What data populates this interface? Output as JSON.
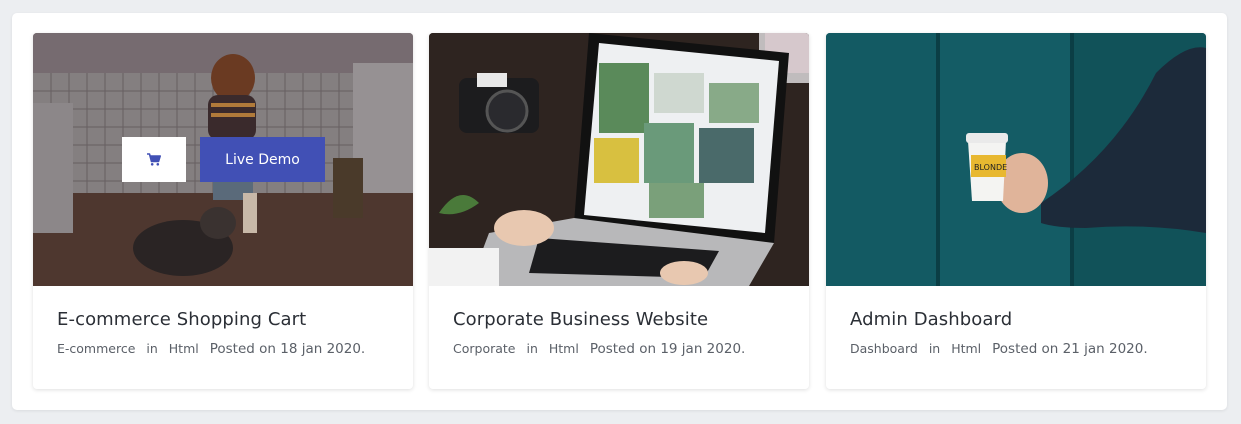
{
  "cards": [
    {
      "title": "E-commerce Shopping Cart",
      "category": "E-commerce",
      "in_word": "in",
      "tech": "Html",
      "posted": "Posted on 18 jan 2020.",
      "image_icon": "photo-woman-with-dog",
      "actions": {
        "cart_icon": "cart-icon",
        "demo_label": "Live Demo"
      }
    },
    {
      "title": "Corporate Business Website",
      "category": "Corporate",
      "in_word": "in",
      "tech": "Html",
      "posted": "Posted on 19 jan 2020.",
      "image_icon": "photo-laptop-desk"
    },
    {
      "title": "Admin Dashboard",
      "category": "Dashboard",
      "in_word": "in",
      "tech": "Html",
      "posted": "Posted on 21 jan 2020.",
      "image_icon": "photo-hand-coffee-cup"
    }
  ],
  "colors": {
    "accent": "#4150b5",
    "page_bg": "#eceef1",
    "title_text": "#2b2f36",
    "meta_text": "#5b6068"
  }
}
